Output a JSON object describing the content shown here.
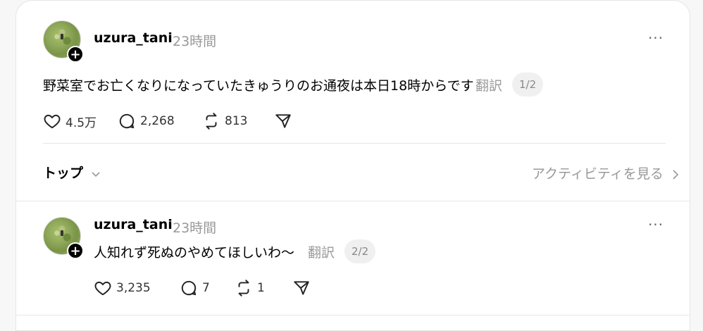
{
  "post1": {
    "username": "uzura_tani",
    "time": "23時間",
    "more": "···",
    "text": "野菜室でお亡くなりになっていたきゅうりのお通夜は本日18時からです",
    "translate": "翻訳",
    "page": "1/2",
    "likes": "4.5万",
    "comments": "2,268",
    "reposts": "813"
  },
  "sort": {
    "label": "トップ",
    "activity": "アクティビティを見る"
  },
  "post2": {
    "username": "uzura_tani",
    "time": "23時間",
    "more": "···",
    "text": "人知れず死ぬのやめてほしいわ〜",
    "translate": "翻訳",
    "page": "2/2",
    "likes": "3,235",
    "comments": "7",
    "reposts": "1"
  },
  "icons": {
    "plus": "+"
  },
  "colors": {
    "text": "#000000",
    "muted": "#999999",
    "divider": "#e6e6e6",
    "pill_bg": "#f0f0f0"
  }
}
